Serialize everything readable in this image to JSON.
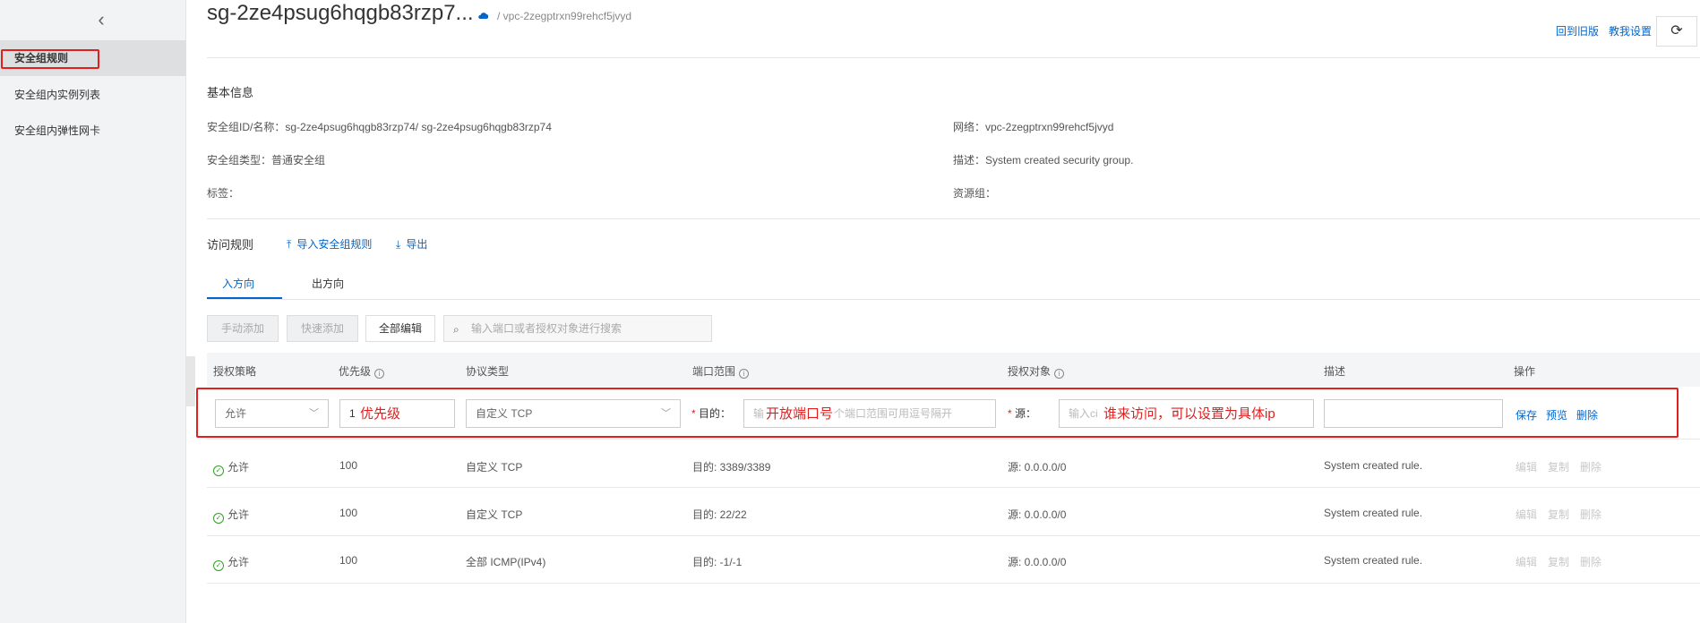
{
  "sidebar": {
    "items": [
      {
        "label": "安全组规则"
      },
      {
        "label": "安全组内实例列表"
      },
      {
        "label": "安全组内弹性网卡"
      }
    ]
  },
  "header": {
    "title": "sg-2ze4psug6hqgb83rzp7...",
    "vpc": "/ vpc-2zegptrxn99rehcf5jvyd",
    "back_old": "回到旧版",
    "teach": "教我设置"
  },
  "basic": {
    "title": "基本信息",
    "id_name": "安全组ID/名称：sg-2ze4psug6hqgb83rzp74/ sg-2ze4psug6hqgb83rzp74",
    "type": "安全组类型：普通安全组",
    "tags": "标签：",
    "network": "网络：vpc-2zegptrxn99rehcf5jvyd",
    "desc": "描述：System created security group.",
    "resource_group": "资源组："
  },
  "rules": {
    "title": "访问规则",
    "import": "导入安全组规则",
    "export": "导出",
    "tabs": [
      "入方向",
      "出方向"
    ],
    "buttons": {
      "manual": "手动添加",
      "quick": "快速添加",
      "edit_all": "全部编辑"
    },
    "search_placeholder": "输入端口或者授权对象进行搜索",
    "headers": [
      "授权策略",
      "优先级",
      "协议类型",
      "端口范围",
      "授权对象",
      "描述",
      "操作"
    ],
    "edit_row": {
      "policy": "允许",
      "priority": "1",
      "priority_note": "优先级",
      "protocol": "自定义 TCP",
      "dest_label": "目的：",
      "dest_placeholder_a": "输",
      "dest_placeholder_b": "个端口范围可用逗号隔开",
      "port_note": "开放端口号",
      "src_label": "源：",
      "src_placeholder_a": "输入ci",
      "src_placeholder_b": "d",
      "src_note": "谁来访问，可以设置为具体ip",
      "save": "保存",
      "preview": "预览",
      "delete": "删除"
    },
    "rows": [
      {
        "policy": "允许",
        "priority": "100",
        "protocol": "自定义 TCP",
        "port": "目的: 3389/3389",
        "source": "源: 0.0.0.0/0",
        "desc": "System created rule.",
        "ops": [
          "编辑",
          "复制",
          "删除"
        ]
      },
      {
        "policy": "允许",
        "priority": "100",
        "protocol": "自定义 TCP",
        "port": "目的: 22/22",
        "source": "源: 0.0.0.0/0",
        "desc": "System created rule.",
        "ops": [
          "编辑",
          "复制",
          "删除"
        ]
      },
      {
        "policy": "允许",
        "priority": "100",
        "protocol": "全部 ICMP(IPv4)",
        "port": "目的: -1/-1",
        "source": "源: 0.0.0.0/0",
        "desc": "System created rule.",
        "ops": [
          "编辑",
          "复制",
          "删除"
        ]
      }
    ]
  },
  "colors": {
    "accent": "#0066cc",
    "annotation": "#e01f1f",
    "ok": "#2ea121"
  }
}
